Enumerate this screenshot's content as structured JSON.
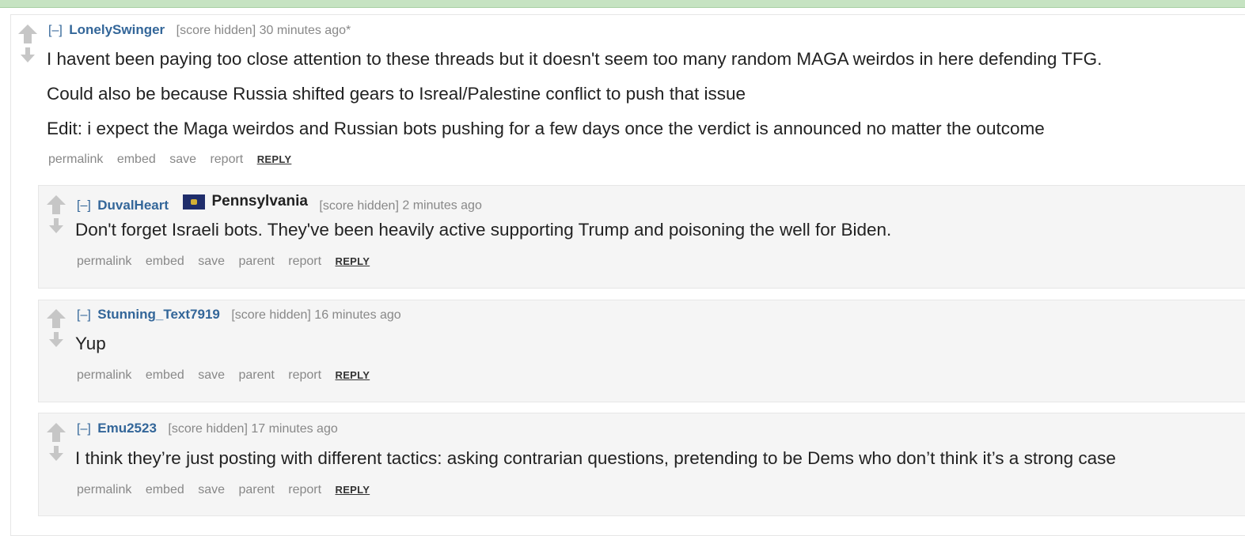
{
  "comments": [
    {
      "toggle": "[–]",
      "author": "LonelySwinger",
      "score": "[score hidden]",
      "time": "30 minutes ago*",
      "paragraphs": [
        "I havent been paying too close attention to these threads but it doesn't seem too many random MAGA weirdos in here defending TFG.",
        "Could also be because Russia shifted gears to Isreal/Palestine conflict to push that issue",
        "Edit: i expect the Maga weirdos and Russian bots pushing for a few days once the verdict is announced no matter the outcome"
      ],
      "actions": [
        "permalink",
        "embed",
        "save",
        "report"
      ],
      "reply": "REPLY"
    },
    {
      "toggle": "[–]",
      "author": "DuvalHeart",
      "flair": "Pennsylvania",
      "score": "[score hidden]",
      "time": "2 minutes ago",
      "paragraphs": [
        "Don't forget Israeli bots. They've been heavily active supporting Trump and poisoning the well for Biden."
      ],
      "actions": [
        "permalink",
        "embed",
        "save",
        "parent",
        "report"
      ],
      "reply": "REPLY"
    },
    {
      "toggle": "[–]",
      "author": "Stunning_Text7919",
      "score": "[score hidden]",
      "time": "16 minutes ago",
      "paragraphs": [
        "Yup"
      ],
      "actions": [
        "permalink",
        "embed",
        "save",
        "parent",
        "report"
      ],
      "reply": "REPLY"
    },
    {
      "toggle": "[–]",
      "author": "Emu2523",
      "score": "[score hidden]",
      "time": "17 minutes ago",
      "paragraphs": [
        "I think they’re just posting with different tactics: asking contrarian questions, pretending to be Dems who don’t think it’s a strong case"
      ],
      "actions": [
        "permalink",
        "embed",
        "save",
        "parent",
        "report"
      ],
      "reply": "REPLY"
    }
  ],
  "icons": {
    "upvote": "up-arrow-icon",
    "downvote": "down-arrow-icon",
    "flair": "pennsylvania-flag-icon"
  },
  "colors": {
    "author": "#336699",
    "meta": "#888888",
    "child_bg": "#f5f5f5",
    "topbar": "#c6e3c2"
  }
}
